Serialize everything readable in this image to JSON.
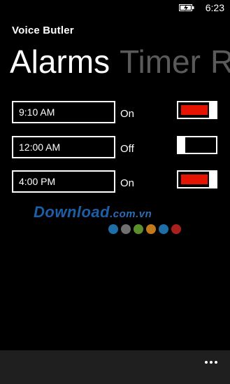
{
  "status_bar": {
    "battery_icon": "battery-charging-icon",
    "time": "6:23"
  },
  "app": {
    "title": "Voice Butler"
  },
  "pivot": {
    "headers": [
      {
        "label": "Alarms",
        "active": true
      },
      {
        "label": "Timer",
        "active": false
      },
      {
        "label": "R",
        "active": false
      }
    ]
  },
  "alarms": [
    {
      "time": "9:10 AM",
      "status": "On",
      "enabled": true
    },
    {
      "time": "12:00 AM",
      "status": "Off",
      "enabled": false
    },
    {
      "time": "4:00 PM",
      "status": "On",
      "enabled": true
    }
  ],
  "watermark": {
    "main": "Download",
    "suffix": ".com.vn",
    "dot_colors": [
      "#1e6ea8",
      "#707070",
      "#5a8f2c",
      "#c07a19",
      "#1e6ea8",
      "#a8201e"
    ]
  },
  "app_bar": {
    "more_icon": "ellipsis-icon"
  },
  "colors": {
    "accent": "#e51400",
    "background": "#000000",
    "app_bar": "#1f1f1f"
  }
}
